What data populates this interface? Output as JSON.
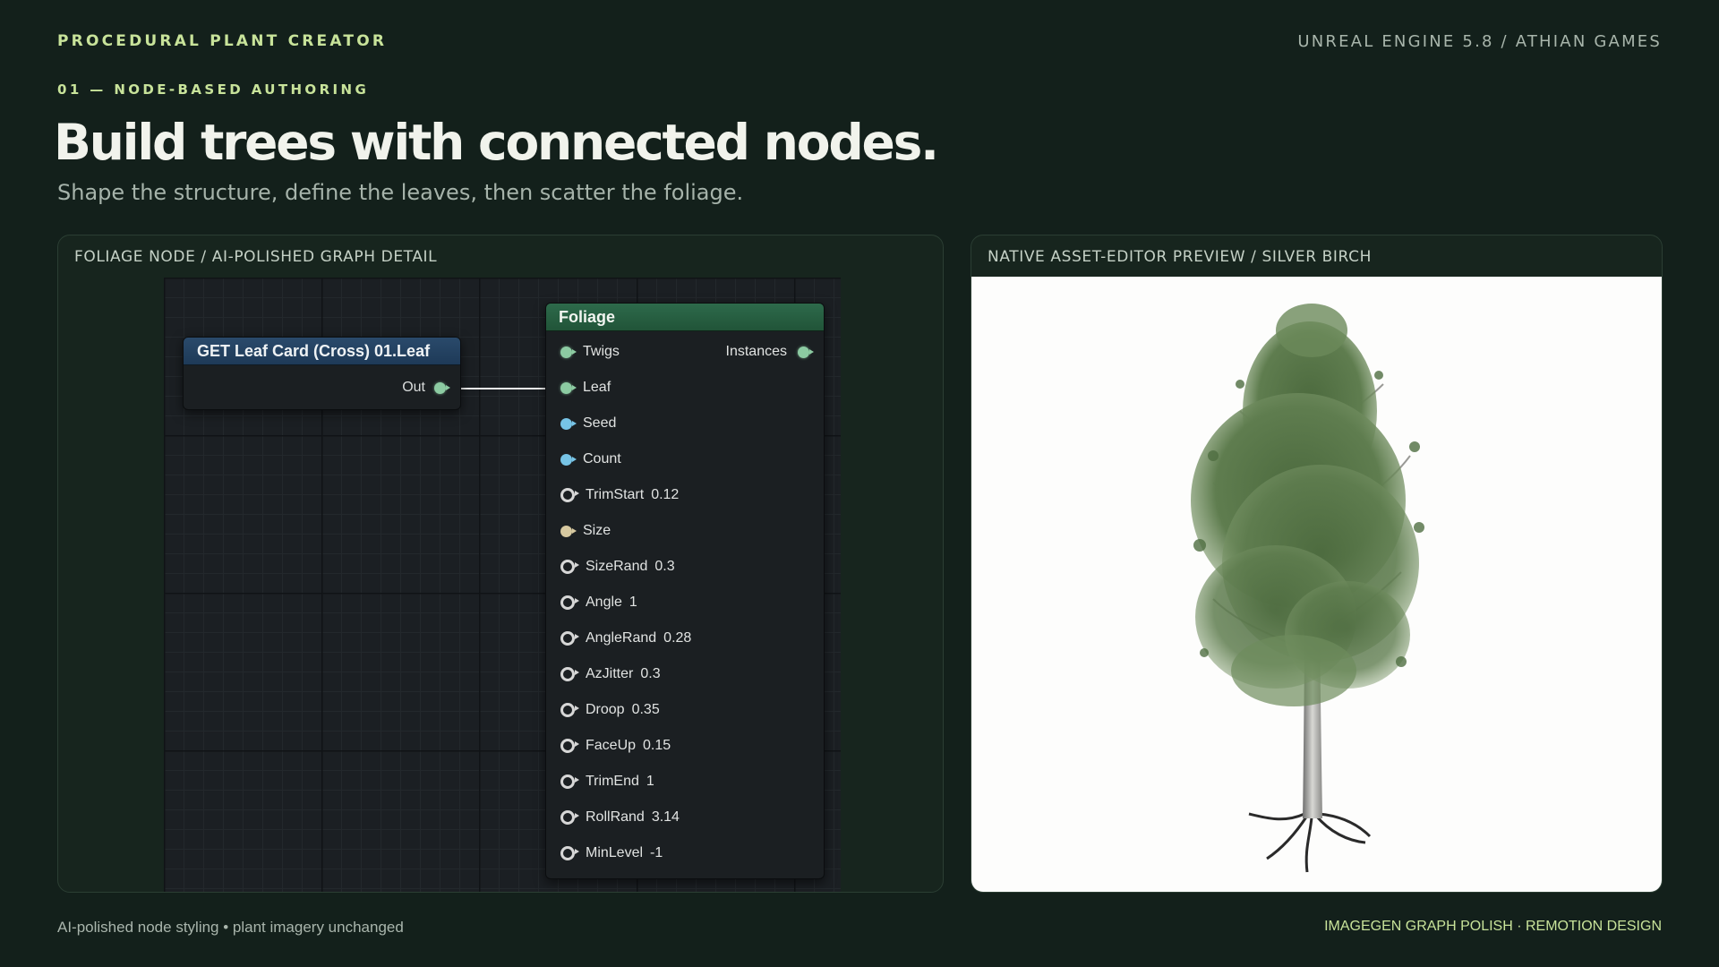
{
  "header": {
    "brand": "PROCEDURAL PLANT CREATOR",
    "engine": "UNREAL ENGINE 5.8 / ATHIAN GAMES"
  },
  "intro": {
    "eyebrow": "01 — NODE-BASED AUTHORING",
    "headline": "Build trees with connected nodes.",
    "subhead": "Shape the structure, define the leaves, then scatter the foliage."
  },
  "left_panel": {
    "title": "FOLIAGE NODE / AI-POLISHED GRAPH DETAIL",
    "get_node": {
      "title": "GET Leaf Card  (Cross) 01.Leaf",
      "output_label": "Out"
    },
    "foliage_node": {
      "title": "Foliage",
      "output_label": "Instances",
      "inputs": [
        {
          "label": "Twigs",
          "value": "",
          "pin": "exec-green"
        },
        {
          "label": "Leaf",
          "value": "",
          "pin": "exec-green"
        },
        {
          "label": "Seed",
          "value": "",
          "pin": "blue"
        },
        {
          "label": "Count",
          "value": "",
          "pin": "blue"
        },
        {
          "label": "TrimStart",
          "value": "0.12",
          "pin": "hollow"
        },
        {
          "label": "Size",
          "value": "",
          "pin": "tan"
        },
        {
          "label": "SizeRand",
          "value": "0.3",
          "pin": "hollow"
        },
        {
          "label": "Angle",
          "value": "1",
          "pin": "hollow"
        },
        {
          "label": "AngleRand",
          "value": "0.28",
          "pin": "hollow"
        },
        {
          "label": "AzJitter",
          "value": "0.3",
          "pin": "hollow"
        },
        {
          "label": "Droop",
          "value": "0.35",
          "pin": "hollow"
        },
        {
          "label": "FaceUp",
          "value": "0.15",
          "pin": "hollow"
        },
        {
          "label": "TrimEnd",
          "value": "1",
          "pin": "hollow"
        },
        {
          "label": "RollRand",
          "value": "3.14",
          "pin": "hollow"
        },
        {
          "label": "MinLevel",
          "value": "-1",
          "pin": "hollow"
        }
      ]
    }
  },
  "right_panel": {
    "title": "NATIVE ASSET-EDITOR PREVIEW / SILVER BIRCH"
  },
  "footer": {
    "left": "AI-polished node styling • plant imagery unchanged",
    "right": "IMAGEGEN GRAPH POLISH · REMOTION DESIGN"
  },
  "colors": {
    "background": "#13201b",
    "accent": "#c8e39a",
    "get_node_header": "#1e3a58",
    "foliage_node_header": "#215438"
  }
}
